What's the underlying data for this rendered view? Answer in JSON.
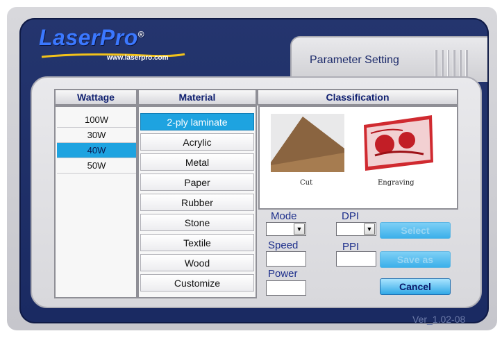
{
  "app": {
    "logo_text": "LaserPro",
    "logo_reg": "®",
    "url": "www.laserpro.com",
    "tab_title": "Parameter Setting",
    "version": "Ver_1.02-08"
  },
  "columns": {
    "wattage": "Wattage",
    "material": "Material",
    "classification": "Classification"
  },
  "wattage": {
    "items": [
      "100W",
      "30W",
      "40W",
      "50W"
    ],
    "selected": "40W"
  },
  "material": {
    "items": [
      "2-ply laminate",
      "Acrylic",
      "Metal",
      "Paper",
      "Rubber",
      "Stone",
      "Textile",
      "Wood",
      "Customize"
    ],
    "selected": "2-ply laminate"
  },
  "classification": {
    "cut_label": "Cut",
    "engraving_label": "Engraving"
  },
  "controls": {
    "mode_label": "Mode",
    "dpi_label": "DPI",
    "speed_label": "Speed",
    "ppi_label": "PPI",
    "power_label": "Power",
    "mode_value": "",
    "dpi_value": "",
    "speed_value": "",
    "ppi_value": "",
    "power_value": ""
  },
  "buttons": {
    "select": "Select",
    "save_as": "Save as",
    "cancel": "Cancel"
  },
  "colors": {
    "frame": "#1a2a62",
    "selection": "#1ea3e0",
    "header_text": "#102070"
  }
}
